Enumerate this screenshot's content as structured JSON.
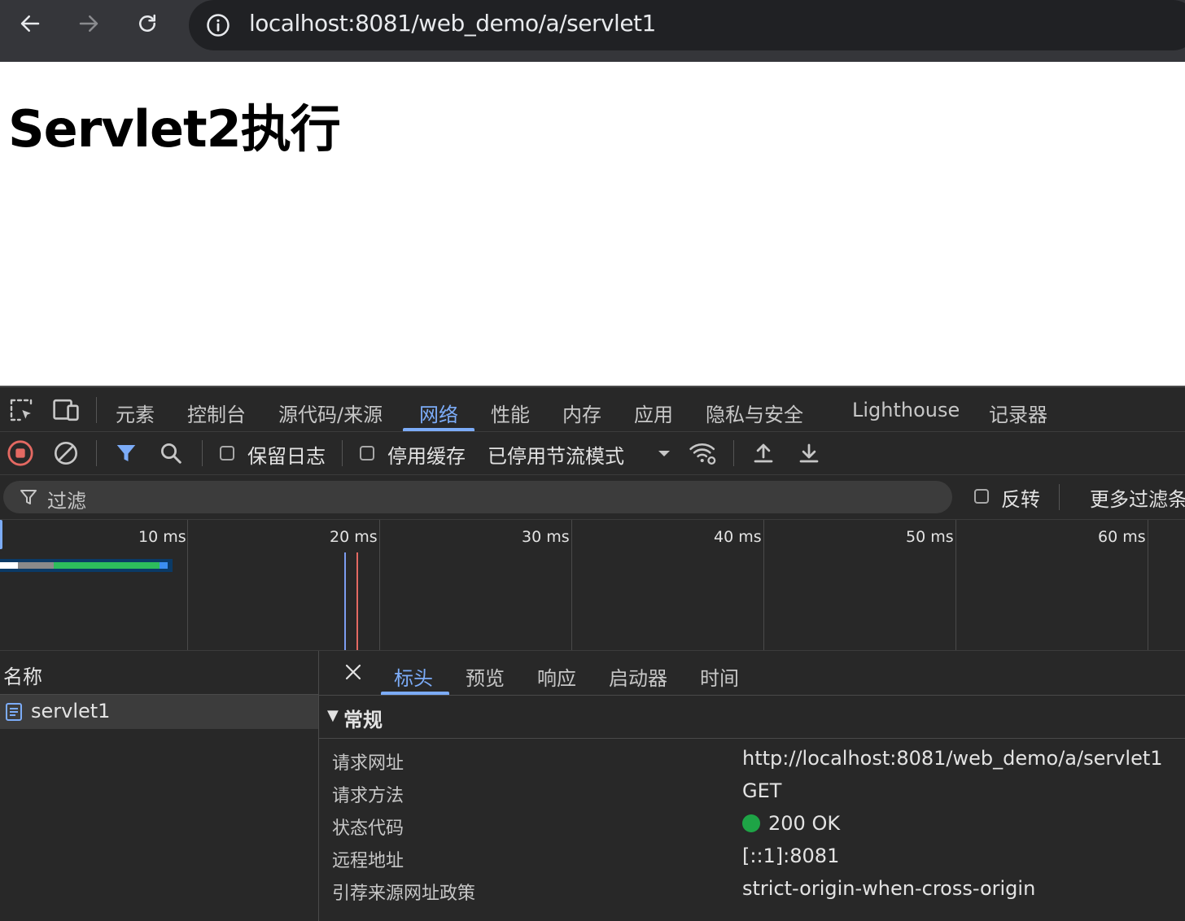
{
  "browser": {
    "url": "localhost:8081/web_demo/a/servlet1"
  },
  "page": {
    "heading": "Servlet2执行"
  },
  "devtools": {
    "panel_tabs": [
      "元素",
      "控制台",
      "源代码/来源",
      "网络",
      "性能",
      "内存",
      "应用",
      "隐私与安全",
      "Lighthouse",
      "记录器"
    ],
    "active_panel": "网络",
    "toolbar": {
      "preserve_log": "保留日志",
      "disable_cache": "停用缓存",
      "throttling": "已停用节流模式"
    },
    "filter": {
      "placeholder": "过滤",
      "invert": "反转",
      "more_filters": "更多过滤条"
    },
    "timeline": {
      "ticks": [
        "10 ms",
        "20 ms",
        "30 ms",
        "40 ms",
        "50 ms",
        "60 ms"
      ]
    },
    "requests": {
      "header": "名称",
      "items": [
        {
          "name": "servlet1"
        }
      ]
    },
    "detail": {
      "tabs": [
        "标头",
        "预览",
        "响应",
        "启动器",
        "时间"
      ],
      "active_tab": "标头",
      "section_title": "常规",
      "general": [
        {
          "key": "请求网址",
          "value": "http://localhost:8081/web_demo/a/servlet1"
        },
        {
          "key": "请求方法",
          "value": "GET"
        },
        {
          "key": "状态代码",
          "value": "200 OK"
        },
        {
          "key": "远程地址",
          "value": "[::1]:8081"
        },
        {
          "key": "引荐来源网址政策",
          "value": "strict-origin-when-cross-origin"
        }
      ]
    }
  },
  "colors": {
    "accent": "#7cacf8",
    "status_ok": "#1ea446",
    "record": "#e46962"
  }
}
